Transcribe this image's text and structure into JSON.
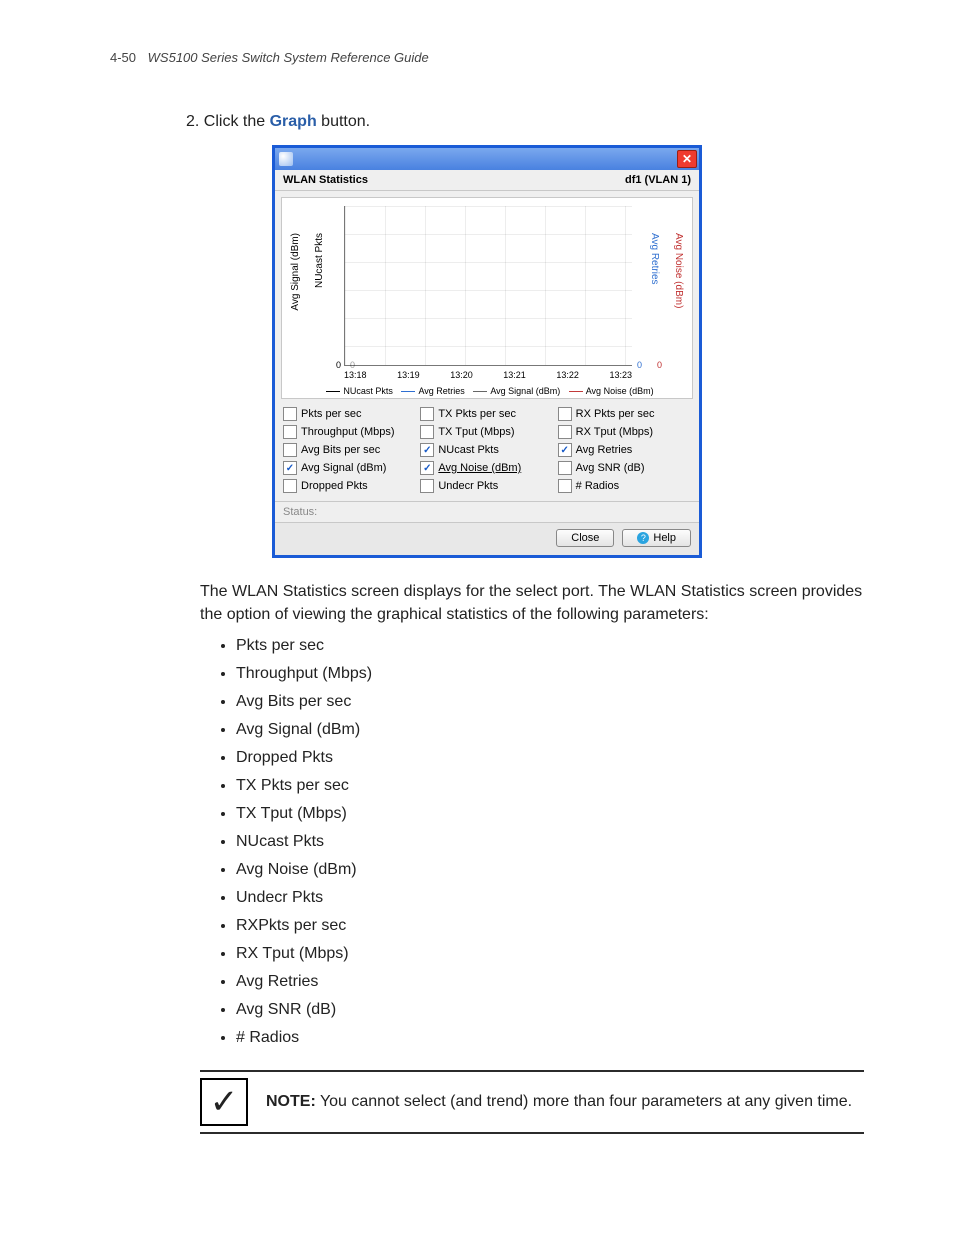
{
  "header": {
    "page_number": "4-50",
    "doc_title": "WS5100 Series Switch System Reference Guide"
  },
  "step": {
    "num": "2.",
    "pre": "Click the ",
    "link": "Graph",
    "post": " button."
  },
  "dialog": {
    "title_left": "WLAN Statistics",
    "title_right": "df1 (VLAN 1)",
    "status_label": "Status:",
    "close_label": "Close",
    "help_label": "Help"
  },
  "chart_data": {
    "type": "line",
    "x": [
      "13:18",
      "13:19",
      "13:20",
      "13:21",
      "13:22",
      "13:23"
    ],
    "series": [
      {
        "name": "NUcast Pkts",
        "color": "#000000",
        "values": []
      },
      {
        "name": "Avg Retries",
        "color": "#2f6fd2",
        "values": []
      },
      {
        "name": "Avg Signal (dBm)",
        "color": "#666666",
        "values": []
      },
      {
        "name": "Avg Noise (dBm)",
        "color": "#c23a3a",
        "values": []
      }
    ],
    "left_axes": [
      {
        "label": "Avg Signal (dBm)",
        "zero": "0"
      },
      {
        "label": "NUcast Pkts",
        "zero": "0"
      }
    ],
    "right_axes": [
      {
        "label": "Avg Retries",
        "zero": "0",
        "color": "#2f6fd2"
      },
      {
        "label": "Avg Noise (dBm)",
        "zero": "0",
        "color": "#c23a3a"
      }
    ]
  },
  "checkboxes": [
    [
      {
        "label": "Pkts per sec",
        "checked": false
      },
      {
        "label": "TX Pkts per sec",
        "checked": false
      },
      {
        "label": "RX Pkts per sec",
        "checked": false
      }
    ],
    [
      {
        "label": "Throughput (Mbps)",
        "checked": false
      },
      {
        "label": "TX Tput (Mbps)",
        "checked": false
      },
      {
        "label": "RX Tput (Mbps)",
        "checked": false
      }
    ],
    [
      {
        "label": "Avg Bits per sec",
        "checked": false
      },
      {
        "label": "NUcast Pkts",
        "checked": true,
        "color": "#000"
      },
      {
        "label": "Avg Retries",
        "checked": true,
        "color": "#2f6fd2"
      }
    ],
    [
      {
        "label": "Avg Signal (dBm)",
        "checked": true,
        "color": "#888"
      },
      {
        "label": "Avg Noise (dBm)",
        "checked": true,
        "color": "#c23a3a",
        "underline": true
      },
      {
        "label": "Avg SNR (dB)",
        "checked": false
      }
    ],
    [
      {
        "label": "Dropped Pkts",
        "checked": false
      },
      {
        "label": "Undecr Pkts",
        "checked": false
      },
      {
        "label": "# Radios",
        "checked": false
      }
    ]
  ],
  "body": {
    "para": "The WLAN Statistics screen displays for the select port. The WLAN Statistics screen provides the option of viewing the graphical statistics of the following parameters:",
    "params": [
      "Pkts per sec",
      "Throughput (Mbps)",
      "Avg Bits per sec",
      "Avg Signal (dBm)",
      "Dropped Pkts",
      "TX Pkts per sec",
      "TX Tput (Mbps)",
      "NUcast Pkts",
      "Avg Noise (dBm)",
      "Undecr Pkts",
      "RXPkts per sec",
      "RX Tput (Mbps)",
      "Avg Retries",
      "Avg SNR (dB)",
      "# Radios"
    ]
  },
  "note": {
    "label": "NOTE:",
    "text": " You cannot select (and trend) more than four parameters at any given time."
  }
}
